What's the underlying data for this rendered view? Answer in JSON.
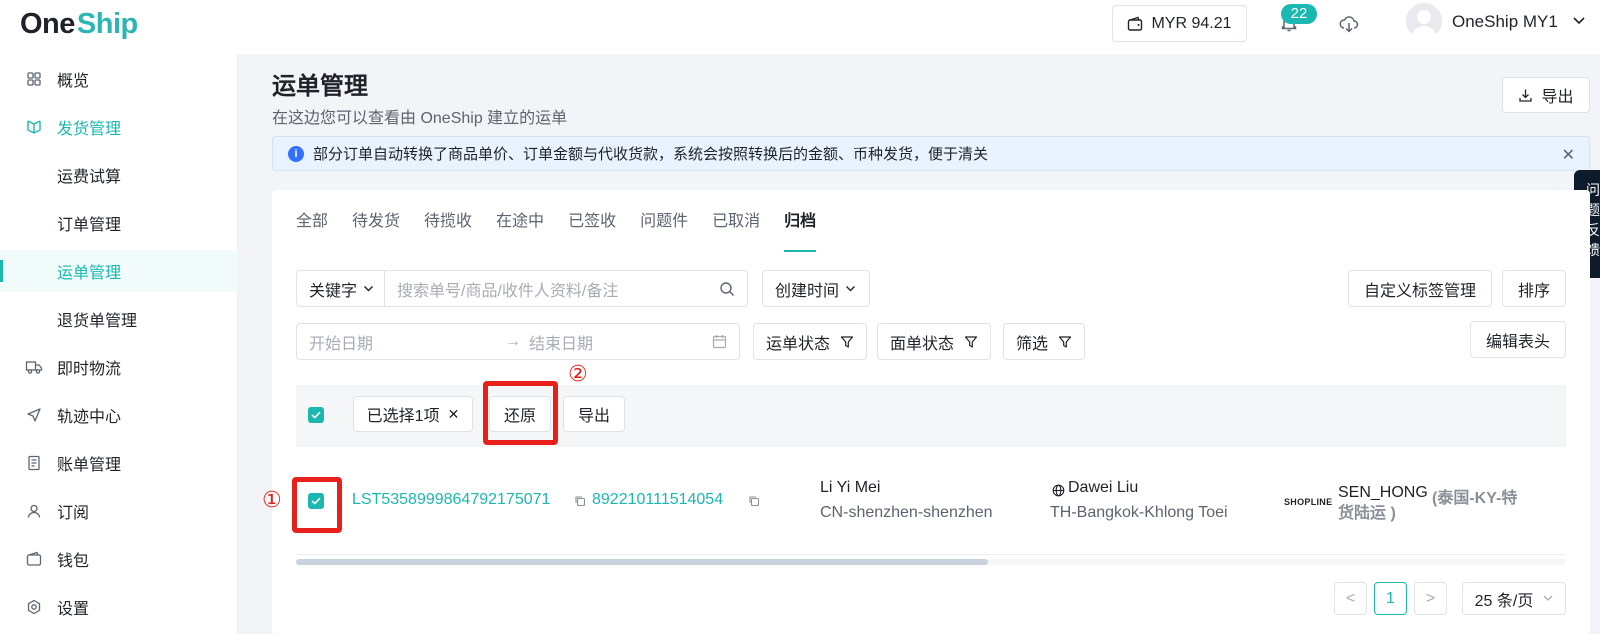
{
  "brand": {
    "logo_one": "One",
    "logo_ship": "Ship"
  },
  "header": {
    "wallet_amount": "MYR 94.21",
    "notification_count": "22",
    "user_name": "OneShip MY1"
  },
  "sidebar": {
    "items": [
      {
        "label": "概览",
        "icon": "grid-icon"
      },
      {
        "label": "发货管理",
        "icon": "parcel-icon"
      },
      {
        "label": "运费试算"
      },
      {
        "label": "订单管理"
      },
      {
        "label": "运单管理"
      },
      {
        "label": "退货单管理"
      },
      {
        "label": "即时物流",
        "icon": "truck-icon"
      },
      {
        "label": "轨迹中心",
        "icon": "send-icon"
      },
      {
        "label": "账单管理",
        "icon": "bill-icon"
      },
      {
        "label": "订阅",
        "icon": "user-icon"
      },
      {
        "label": "钱包",
        "icon": "wallet-icon"
      },
      {
        "label": "设置",
        "icon": "gear-icon"
      }
    ]
  },
  "page": {
    "title": "运单管理",
    "subtitle": "在这边您可以查看由 OneShip 建立的运单",
    "export_label": "导出",
    "notice": "部分订单自动转换了商品单价、订单金额与代收货款，系统会按照转换后的金额、币种发货，便于清关",
    "side_tab_text": "问题反馈"
  },
  "tabs": [
    "全部",
    "待发货",
    "待揽收",
    "在途中",
    "已签收",
    "问题件",
    "已取消",
    "归档"
  ],
  "filters": {
    "keyword_label": "关键字",
    "search_placeholder": "搜索单号/商品/收件人资料/备注",
    "created_time_label": "创建时间",
    "custom_tag_label": "自定义标签管理",
    "sort_label": "排序",
    "start_date_placeholder": "开始日期",
    "end_date_placeholder": "结束日期",
    "waybill_status_label": "运单状态",
    "label_status_label": "面单状态",
    "filter_label": "筛选",
    "edit_columns_label": "编辑表头"
  },
  "bulk": {
    "selected_label": "已选择1项",
    "restore_label": "还原",
    "export_label": "导出",
    "marker_1": "①",
    "marker_2": "②"
  },
  "row": {
    "tracking_no": "LST5358999864792175071",
    "order_no": "892210111514054",
    "sender_name": "Li Yi Mei",
    "sender_location": "CN-shenzhen-shenzhen",
    "recipient_name": "Dawei Liu",
    "recipient_location": "TH-Bangkok-Khlong Toei",
    "platform": "SHOPLINE",
    "carrier_code": "SEN_HONG",
    "carrier_desc_1": "(泰国-KY-特",
    "carrier_desc_2": "货陆运 )"
  },
  "pagination": {
    "prev": "<",
    "current_page": "1",
    "next": ">",
    "page_size": "25 条/页"
  },
  "colors": {
    "accent": "#1ab8b0",
    "annotation": "#e8201c",
    "info": "#3370ff"
  }
}
